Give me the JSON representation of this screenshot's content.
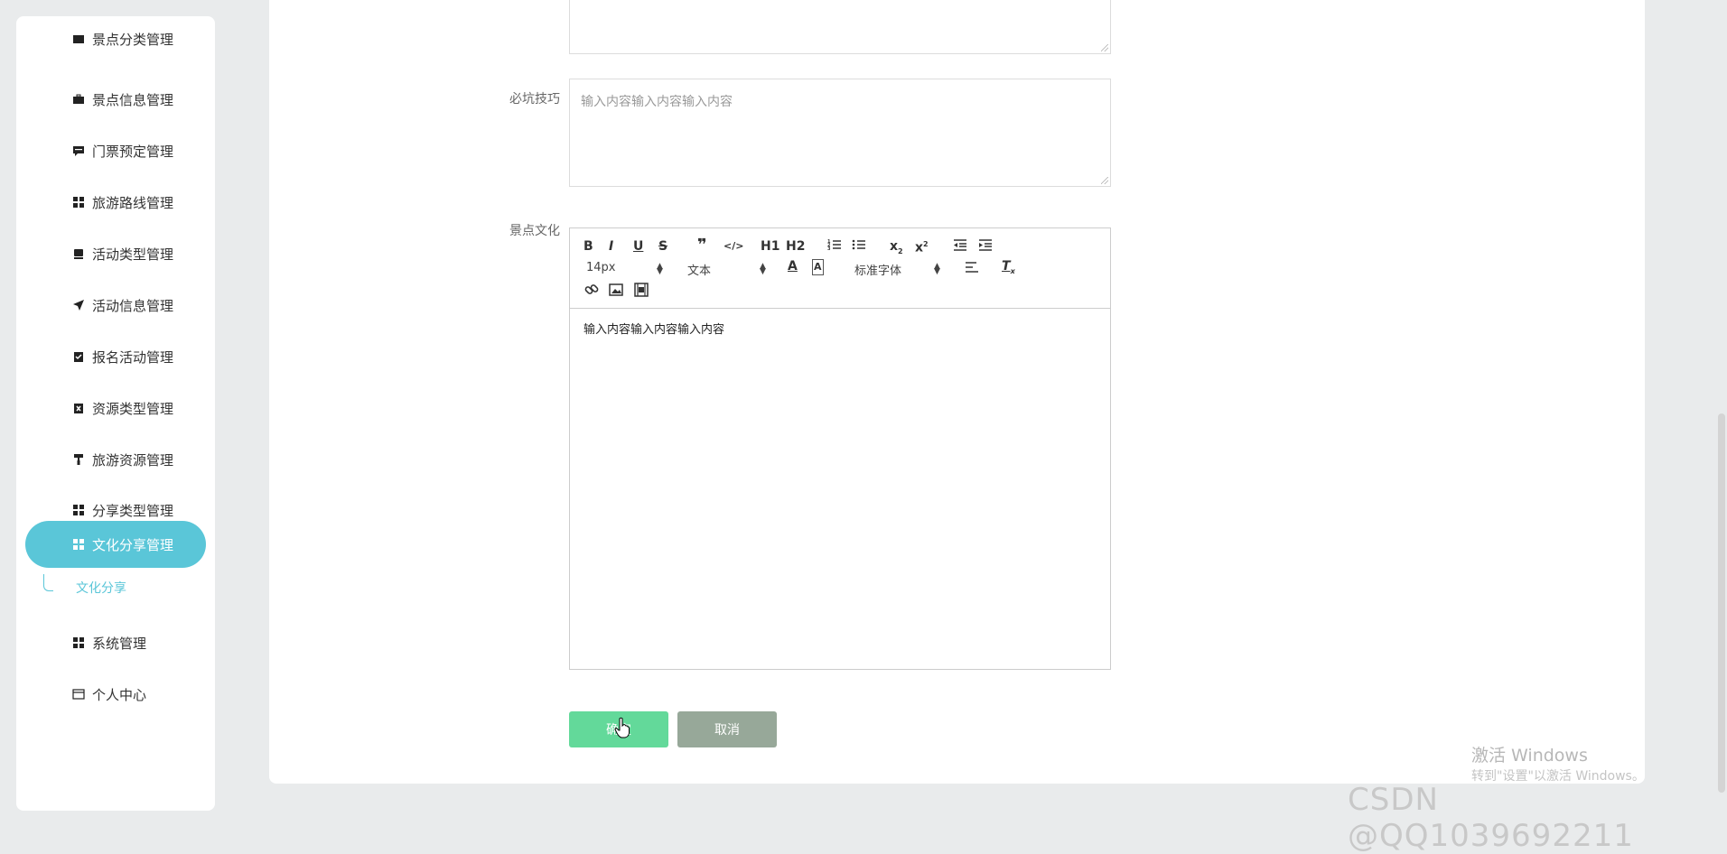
{
  "sidebar": {
    "items": [
      {
        "label": "景点分类管理",
        "icon": "list-icon"
      },
      {
        "label": "景点信息管理",
        "icon": "briefcase-icon"
      },
      {
        "label": "门票预定管理",
        "icon": "comment-icon"
      },
      {
        "label": "旅游路线管理",
        "icon": "grid-icon"
      },
      {
        "label": "活动类型管理",
        "icon": "hdd-icon"
      },
      {
        "label": "活动信息管理",
        "icon": "send-icon"
      },
      {
        "label": "报名活动管理",
        "icon": "clipboard-check-icon"
      },
      {
        "label": "资源类型管理",
        "icon": "clipboard-x-icon"
      },
      {
        "label": "旅游资源管理",
        "icon": "paint-roller-icon"
      },
      {
        "label": "分享类型管理",
        "icon": "grid-icon"
      },
      {
        "label": "文化分享管理",
        "icon": "grid-icon"
      },
      {
        "label": "系统管理",
        "icon": "grid-icon"
      },
      {
        "label": "个人中心",
        "icon": "window-icon"
      }
    ],
    "active_index": 10,
    "submenu_label": "文化分享"
  },
  "form": {
    "tips_label": "必坑技巧",
    "tips_value": "输入内容输入内容输入内容",
    "culture_label": "景点文化",
    "editor_content": "输入内容输入内容输入内容"
  },
  "toolbar": {
    "font_size": "14px",
    "text_style": "文本",
    "font_family": "标准字体",
    "h1": "H1",
    "h2": "H2"
  },
  "buttons": {
    "confirm": "确定",
    "cancel": "取消"
  },
  "watermark": {
    "activate_title": "激活 Windows",
    "activate_hint": "转到\"设置\"以激活 Windows。",
    "csdn": "CSDN @QQ1039692211"
  },
  "colors": {
    "accent": "#5ac6d8",
    "confirm": "#63d99a",
    "cancel": "#97a899"
  }
}
